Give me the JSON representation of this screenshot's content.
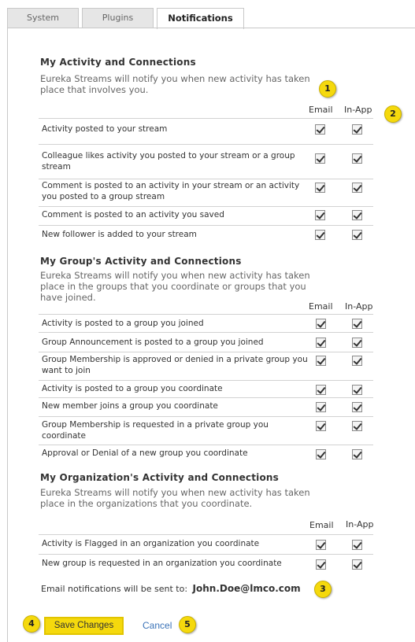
{
  "tabs": [
    {
      "label": "System"
    },
    {
      "label": "Plugins"
    },
    {
      "label": "Notifications"
    }
  ],
  "columns": {
    "email": "Email",
    "inapp": "In-App"
  },
  "sections": [
    {
      "title": "My Activity and Connections",
      "desc": "Eureka Streams will notify you when new activity has taken place that involves you.",
      "rows": [
        {
          "label": "Activity posted to your stream",
          "email": true,
          "inapp": true
        },
        {
          "label": "Colleague likes activity you posted to your stream or a group stream",
          "email": true,
          "inapp": true
        },
        {
          "label": "Comment is posted to an activity in your stream or an activity you posted to a group stream",
          "email": true,
          "inapp": true
        },
        {
          "label": "Comment is posted to an activity you saved",
          "email": true,
          "inapp": true
        },
        {
          "label": "New follower is added to your stream",
          "email": true,
          "inapp": true
        }
      ]
    },
    {
      "title": "My Group's Activity and Connections",
      "desc": "Eureka Streams will notify you when new activity has taken place in the groups that you coordinate or groups that you have joined.",
      "rows": [
        {
          "label": "Activity is posted to a group you joined",
          "email": true,
          "inapp": true
        },
        {
          "label": "Group Announcement is posted to a group you joined",
          "email": true,
          "inapp": true
        },
        {
          "label": "Group Membership is approved or denied in a private group you want to join",
          "email": true,
          "inapp": true
        },
        {
          "label": "Activity is posted to a group you coordinate",
          "email": true,
          "inapp": true
        },
        {
          "label": "New member joins a group you coordinate",
          "email": true,
          "inapp": true
        },
        {
          "label": "Group Membership is requested in a private group you coordinate",
          "email": true,
          "inapp": true
        },
        {
          "label": "Approval or Denial of a new group you coordinate",
          "email": true,
          "inapp": true
        }
      ]
    },
    {
      "title": "My Organization's Activity and Connections",
      "desc": "Eureka Streams will notify you when new activity has taken place in the organizations that you coordinate.",
      "rows": [
        {
          "label": "Activity is Flagged in an organization you coordinate",
          "email": true,
          "inapp": true
        },
        {
          "label": "New group is requested in an organization you coordinate",
          "email": true,
          "inapp": true
        }
      ]
    }
  ],
  "email_notice": {
    "label": "Email notifications will be sent to:",
    "address": "John.Doe@lmco.com"
  },
  "buttons": {
    "save": "Save Changes",
    "cancel": "Cancel"
  },
  "badges": [
    "1",
    "2",
    "3",
    "4",
    "5"
  ],
  "colors": {
    "badge": "#f5d90d",
    "save_button": "#f5d90d",
    "link": "#3b73b8"
  }
}
